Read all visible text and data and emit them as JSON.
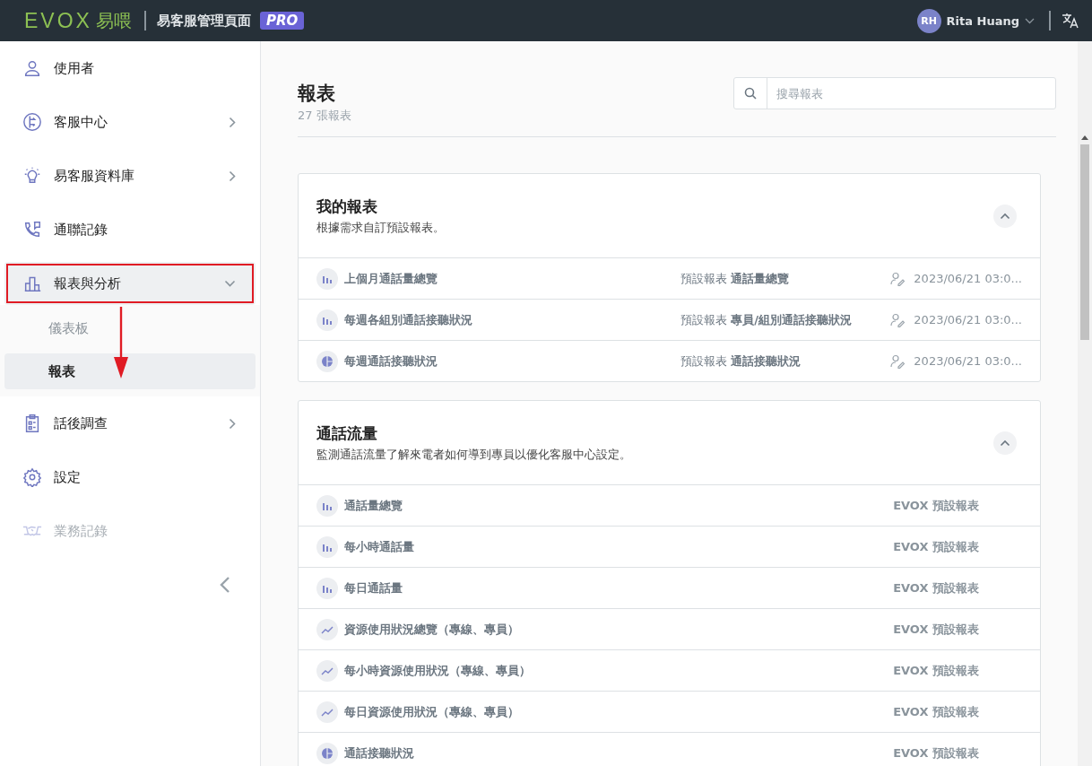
{
  "header": {
    "logo_word": "EVOX",
    "logo_cjk": "易喂",
    "title": "易客服管理頁面",
    "badge": "PRO",
    "user": {
      "initials": "RH",
      "name": "Rita Huang"
    }
  },
  "sidebar": {
    "items": [
      {
        "label": "使用者",
        "expandable": false,
        "expanded": false,
        "disabled": false,
        "highlighted": false
      },
      {
        "label": "客服中心",
        "expandable": true,
        "expanded": false,
        "disabled": false,
        "highlighted": false
      },
      {
        "label": "易客服資料庫",
        "expandable": true,
        "expanded": false,
        "disabled": false,
        "highlighted": false
      },
      {
        "label": "通聯記錄",
        "expandable": false,
        "expanded": false,
        "disabled": false,
        "highlighted": false
      },
      {
        "label": "報表與分析",
        "expandable": true,
        "expanded": true,
        "disabled": false,
        "highlighted": true,
        "children": [
          {
            "label": "儀表板",
            "selected": false
          },
          {
            "label": "報表",
            "selected": true
          }
        ]
      },
      {
        "label": "話後調查",
        "expandable": true,
        "expanded": false,
        "disabled": false,
        "highlighted": false
      },
      {
        "label": "設定",
        "expandable": false,
        "expanded": false,
        "disabled": false,
        "highlighted": false
      },
      {
        "label": "業務記錄",
        "expandable": false,
        "expanded": false,
        "disabled": true,
        "highlighted": false
      }
    ]
  },
  "page": {
    "title": "報表",
    "count": "27 張報表",
    "search": {
      "placeholder": "搜尋報表"
    }
  },
  "sections": [
    {
      "title": "我的報表",
      "description": "根據需求自訂預設報表。",
      "expanded": true,
      "kind": "custom",
      "rows": [
        {
          "kind": "bar",
          "name": "上個月通話量總覽",
          "type": "預設報表",
          "template": "通話量總覽",
          "date": "2023/06/21 03:0..."
        },
        {
          "kind": "bar",
          "name": "每週各組別通話接聽狀況",
          "type": "預設報表",
          "template": "專員/組別通話接聽狀況",
          "date": "2023/06/21 03:0..."
        },
        {
          "kind": "pie",
          "name": "每週通話接聽狀況",
          "type": "預設報表",
          "template": "通話接聽狀況",
          "date": "2023/06/21 03:0..."
        }
      ]
    },
    {
      "title": "通話流量",
      "description": "監測通話流量了解來電者如何導到專員以優化客服中心設定。",
      "expanded": true,
      "kind": "builtin",
      "rows": [
        {
          "kind": "bar",
          "name": "通話量總覽",
          "source": "EVOX 預設報表"
        },
        {
          "kind": "bar",
          "name": "每小時通話量",
          "source": "EVOX 預設報表"
        },
        {
          "kind": "bar",
          "name": "每日通話量",
          "source": "EVOX 預設報表"
        },
        {
          "kind": "line",
          "name": "資源使用狀況總覽（專線、專員）",
          "source": "EVOX 預設報表"
        },
        {
          "kind": "line",
          "name": "每小時資源使用狀況（專線、專員）",
          "source": "EVOX 預設報表"
        },
        {
          "kind": "line",
          "name": "每日資源使用狀況（專線、專員）",
          "source": "EVOX 預設報表"
        },
        {
          "kind": "pie",
          "name": "通話接聽狀況",
          "source": "EVOX 預設報表"
        }
      ]
    }
  ]
}
